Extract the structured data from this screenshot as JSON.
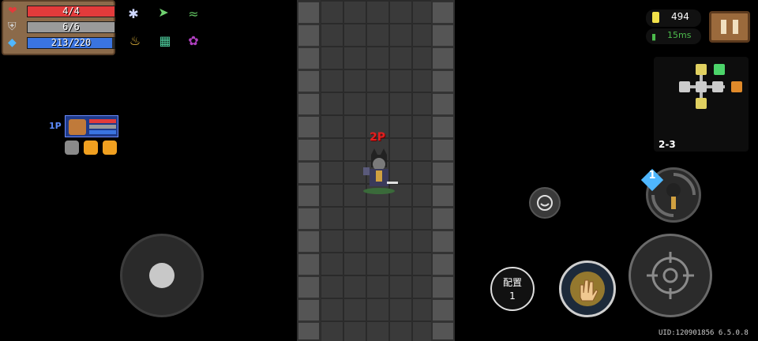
{
  "stats": {
    "hp": {
      "text": "4/4",
      "current": 4,
      "max": 4,
      "color": "#e23b3b"
    },
    "armor": {
      "text": "6/6",
      "current": 6,
      "max": 6,
      "color": "#9a9a9a"
    },
    "energy": {
      "text": "213/220",
      "current": 213,
      "max": 220,
      "color": "#3a74e0"
    }
  },
  "buffs_row1": [
    "spider-buff-icon",
    "speed-feather-buff-icon",
    "wave-buff-icon"
  ],
  "buffs_row2": [
    "magic-lamp-icon",
    "maze-buff-icon",
    "demon-buff-icon"
  ],
  "top_right": {
    "gems": "494",
    "ping": "15ms"
  },
  "minimap": {
    "level": "2-3"
  },
  "players": {
    "p1_label": "1P",
    "p2_label": "2P"
  },
  "controls": {
    "config_label": "配置",
    "config_count": "1",
    "weapon_slot_count": "1"
  },
  "footer": {
    "uid": "UID:120901856 6.5.0.8"
  },
  "colors": {
    "panel": "#8b6a4a",
    "accent_blue": "#4fb7ff",
    "p2_red": "#e02020",
    "ping_green": "#4cbb4c",
    "gem_yellow": "#f3e24a"
  }
}
